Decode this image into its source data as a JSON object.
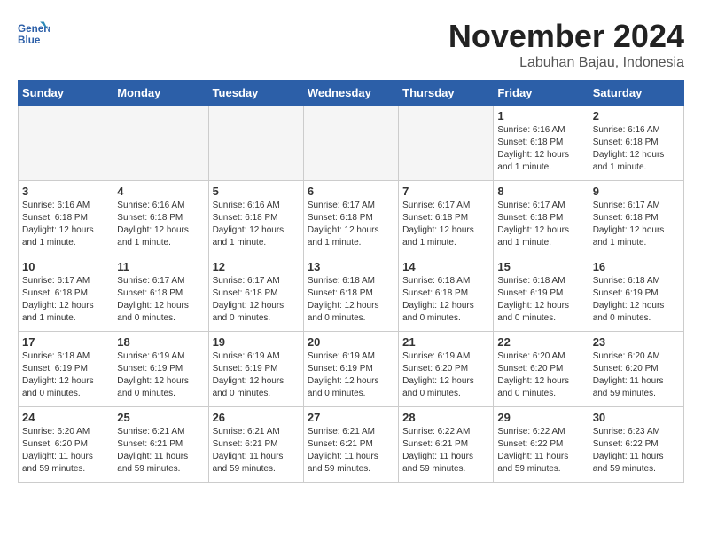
{
  "logo": {
    "line1": "General",
    "line2": "Blue"
  },
  "header": {
    "month": "November 2024",
    "location": "Labuhan Bajau, Indonesia"
  },
  "weekdays": [
    "Sunday",
    "Monday",
    "Tuesday",
    "Wednesday",
    "Thursday",
    "Friday",
    "Saturday"
  ],
  "weeks": [
    [
      {
        "day": "",
        "text": ""
      },
      {
        "day": "",
        "text": ""
      },
      {
        "day": "",
        "text": ""
      },
      {
        "day": "",
        "text": ""
      },
      {
        "day": "",
        "text": ""
      },
      {
        "day": "1",
        "text": "Sunrise: 6:16 AM\nSunset: 6:18 PM\nDaylight: 12 hours and 1 minute."
      },
      {
        "day": "2",
        "text": "Sunrise: 6:16 AM\nSunset: 6:18 PM\nDaylight: 12 hours and 1 minute."
      }
    ],
    [
      {
        "day": "3",
        "text": "Sunrise: 6:16 AM\nSunset: 6:18 PM\nDaylight: 12 hours and 1 minute."
      },
      {
        "day": "4",
        "text": "Sunrise: 6:16 AM\nSunset: 6:18 PM\nDaylight: 12 hours and 1 minute."
      },
      {
        "day": "5",
        "text": "Sunrise: 6:16 AM\nSunset: 6:18 PM\nDaylight: 12 hours and 1 minute."
      },
      {
        "day": "6",
        "text": "Sunrise: 6:17 AM\nSunset: 6:18 PM\nDaylight: 12 hours and 1 minute."
      },
      {
        "day": "7",
        "text": "Sunrise: 6:17 AM\nSunset: 6:18 PM\nDaylight: 12 hours and 1 minute."
      },
      {
        "day": "8",
        "text": "Sunrise: 6:17 AM\nSunset: 6:18 PM\nDaylight: 12 hours and 1 minute."
      },
      {
        "day": "9",
        "text": "Sunrise: 6:17 AM\nSunset: 6:18 PM\nDaylight: 12 hours and 1 minute."
      }
    ],
    [
      {
        "day": "10",
        "text": "Sunrise: 6:17 AM\nSunset: 6:18 PM\nDaylight: 12 hours and 1 minute."
      },
      {
        "day": "11",
        "text": "Sunrise: 6:17 AM\nSunset: 6:18 PM\nDaylight: 12 hours and 0 minutes."
      },
      {
        "day": "12",
        "text": "Sunrise: 6:17 AM\nSunset: 6:18 PM\nDaylight: 12 hours and 0 minutes."
      },
      {
        "day": "13",
        "text": "Sunrise: 6:18 AM\nSunset: 6:18 PM\nDaylight: 12 hours and 0 minutes."
      },
      {
        "day": "14",
        "text": "Sunrise: 6:18 AM\nSunset: 6:18 PM\nDaylight: 12 hours and 0 minutes."
      },
      {
        "day": "15",
        "text": "Sunrise: 6:18 AM\nSunset: 6:19 PM\nDaylight: 12 hours and 0 minutes."
      },
      {
        "day": "16",
        "text": "Sunrise: 6:18 AM\nSunset: 6:19 PM\nDaylight: 12 hours and 0 minutes."
      }
    ],
    [
      {
        "day": "17",
        "text": "Sunrise: 6:18 AM\nSunset: 6:19 PM\nDaylight: 12 hours and 0 minutes."
      },
      {
        "day": "18",
        "text": "Sunrise: 6:19 AM\nSunset: 6:19 PM\nDaylight: 12 hours and 0 minutes."
      },
      {
        "day": "19",
        "text": "Sunrise: 6:19 AM\nSunset: 6:19 PM\nDaylight: 12 hours and 0 minutes."
      },
      {
        "day": "20",
        "text": "Sunrise: 6:19 AM\nSunset: 6:19 PM\nDaylight: 12 hours and 0 minutes."
      },
      {
        "day": "21",
        "text": "Sunrise: 6:19 AM\nSunset: 6:20 PM\nDaylight: 12 hours and 0 minutes."
      },
      {
        "day": "22",
        "text": "Sunrise: 6:20 AM\nSunset: 6:20 PM\nDaylight: 12 hours and 0 minutes."
      },
      {
        "day": "23",
        "text": "Sunrise: 6:20 AM\nSunset: 6:20 PM\nDaylight: 11 hours and 59 minutes."
      }
    ],
    [
      {
        "day": "24",
        "text": "Sunrise: 6:20 AM\nSunset: 6:20 PM\nDaylight: 11 hours and 59 minutes."
      },
      {
        "day": "25",
        "text": "Sunrise: 6:21 AM\nSunset: 6:21 PM\nDaylight: 11 hours and 59 minutes."
      },
      {
        "day": "26",
        "text": "Sunrise: 6:21 AM\nSunset: 6:21 PM\nDaylight: 11 hours and 59 minutes."
      },
      {
        "day": "27",
        "text": "Sunrise: 6:21 AM\nSunset: 6:21 PM\nDaylight: 11 hours and 59 minutes."
      },
      {
        "day": "28",
        "text": "Sunrise: 6:22 AM\nSunset: 6:21 PM\nDaylight: 11 hours and 59 minutes."
      },
      {
        "day": "29",
        "text": "Sunrise: 6:22 AM\nSunset: 6:22 PM\nDaylight: 11 hours and 59 minutes."
      },
      {
        "day": "30",
        "text": "Sunrise: 6:23 AM\nSunset: 6:22 PM\nDaylight: 11 hours and 59 minutes."
      }
    ]
  ]
}
